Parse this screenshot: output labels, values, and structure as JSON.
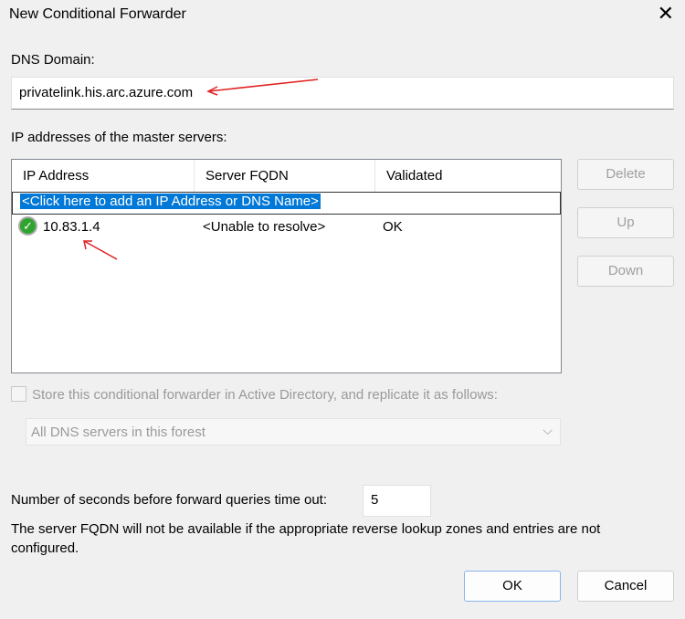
{
  "window": {
    "title": "New Conditional Forwarder",
    "close": "✕"
  },
  "dns_domain": {
    "label": "DNS Domain:",
    "value": "privatelink.his.arc.azure.com"
  },
  "master": {
    "label": "IP addresses of the master servers:",
    "columns": [
      "IP Address",
      "Server FQDN",
      "Validated"
    ],
    "add_row": "<Click here to add an IP Address or DNS Name>",
    "rows": [
      {
        "ip": "10.83.1.4",
        "fqdn": "<Unable to resolve>",
        "validated": "OK"
      }
    ]
  },
  "side_buttons": {
    "delete": "Delete",
    "up": "Up",
    "down": "Down"
  },
  "store": {
    "label": "Store this conditional forwarder in Active Directory, and replicate it as follows:",
    "checked": false,
    "select": "All DNS servers in this forest"
  },
  "timeout": {
    "label": "Number of seconds before forward queries time out:",
    "value": "5"
  },
  "note": "The server FQDN will not be available if the appropriate reverse lookup zones and entries are not configured.",
  "buttons": {
    "ok": "OK",
    "cancel": "Cancel"
  }
}
